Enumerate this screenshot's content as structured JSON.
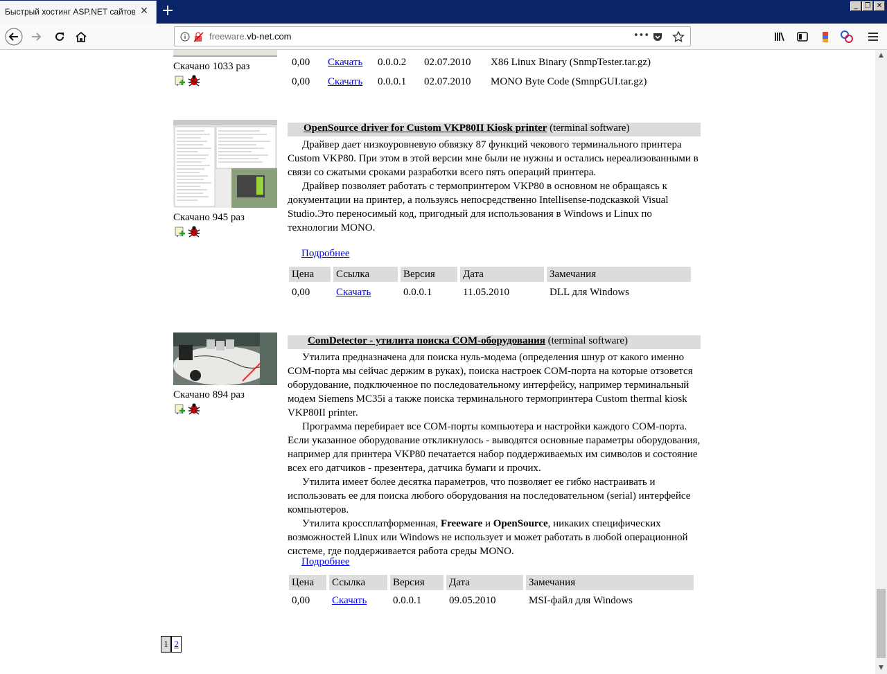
{
  "browser": {
    "tab_title": "Быстрый хостинг ASP.NET сайтов с и",
    "tab_close": "✕",
    "new_tab": "+",
    "url_prefix": "freeware.",
    "url_domain": "vb-net.com",
    "menu_dots": "•••",
    "window_buttons": [
      "_",
      "❐",
      "✕"
    ]
  },
  "items": [
    {
      "downloads": "Скачано 1033 раз",
      "rows": [
        {
          "price": "0,00",
          "link": "Скачать",
          "version": "0.0.0.2",
          "date": "02.07.2010",
          "note": "X86 Linux Binary (SnmpTester.tar.gz)"
        },
        {
          "price": "0,00",
          "link": "Скачать",
          "version": "0.0.0.1",
          "date": "02.07.2010",
          "note": "MONO Byte Code (SmnpGUI.tar.gz)"
        }
      ]
    },
    {
      "title": "OpenSource driver for Custom VKP80II Kiosk printer",
      "category": "(terminal software)",
      "downloads": "Скачано 945 раз",
      "paragraphs": [
        "Драйвер дает низкоуровневую обвязку 87 функций чекового терминального принтера Custom VKP80. При этом в этой версии мне были не нужны и остались нереализованными в связи со сжатыми сроками разработки всего пять операций принтера.",
        "Драйвер позволяет работать с термопринтером VKP80 в основном не обращаясь к документации на принтер, а пользуясь непосредственно Intellisense-подсказкой Visual Studio.Это переносимый код, пригодный для использования в Windows и Linux по технологии MONO."
      ],
      "more": "Подробнее",
      "headers": [
        "Цена",
        "Ссылка",
        "Версия",
        "Дата",
        "Замечания"
      ],
      "rows": [
        {
          "price": "0,00",
          "link": "Скачать",
          "version": "0.0.0.1",
          "date": "11.05.2010",
          "note": "DLL для Windows"
        }
      ]
    },
    {
      "title": "ComDetector - утилита поиска COM-оборудования",
      "category": "(terminal software)",
      "downloads": "Скачано 894 раз",
      "paragraphs": [
        "Утилита предназначена для поиска нуль-модема (определения шнур от какого именно COM-порта мы сейчас держим в руках), поиска настроек COM-порта на которые отзовется оборудование, подключенное по последовательному интерфейсу, например терминальный модем Siemens MC35i а также поиска терминального термопринтера Custom thermal kiosk VKP80II printer.",
        "Программа перебирает все COM-порты компьютера и настройки каждого COM-порта. Если указанное оборудование откликнулось - выводятся основные параметры оборудования, например для принтера VKP80 печатается набор поддерживаемых им символов и состояние всех его датчиков - презентера, датчика бумаги и прочих.",
        "Утилита имеет более десятка параметров, что позволяет ее гибко настраивать и использовать ее для поиска любого оборудования на последовательном (serial) интерфейсе компьютеров."
      ],
      "p4": {
        "before": "Утилита кроссплатформенная, ",
        "b1": "Freeware",
        "mid": " и ",
        "b2": "OpenSource",
        "after": ", никаких специфических возможностей Linux или Windows не использует и может работать в любой операционной системе, где поддерживается работа среды MONO."
      },
      "more": "Подробнее",
      "headers": [
        "Цена",
        "Ссылка",
        "Версия",
        "Дата",
        "Замечания"
      ],
      "rows": [
        {
          "price": "0,00",
          "link": "Скачать",
          "version": "0.0.0.1",
          "date": "09.05.2010",
          "note": "MSI-файл для Windows"
        }
      ]
    }
  ],
  "pager": [
    "1",
    "2"
  ]
}
